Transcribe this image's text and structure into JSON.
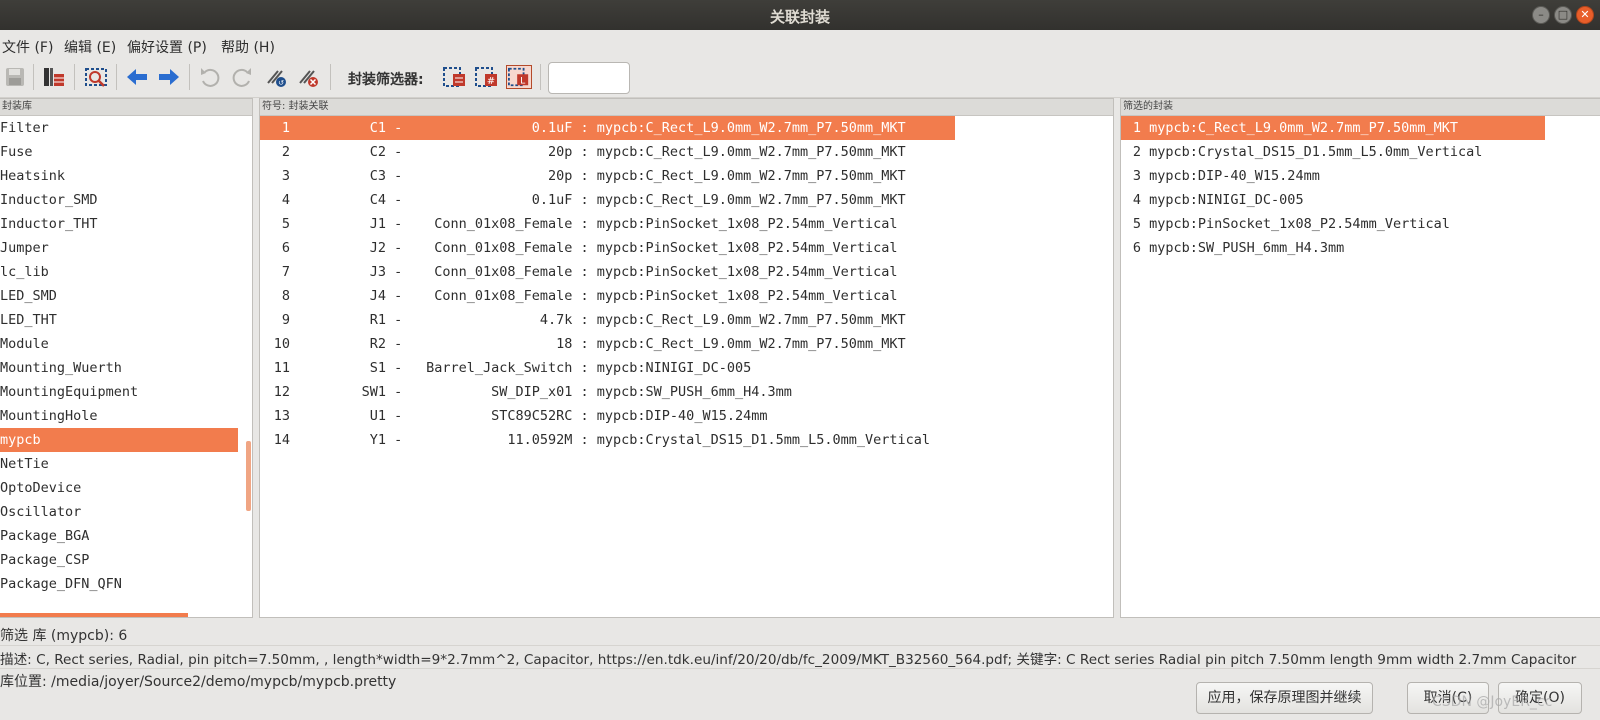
{
  "window": {
    "title": "关联封装"
  },
  "menu": {
    "items": [
      "文件 (F)",
      "编辑 (E)",
      "偏好设置 (P)",
      "帮助 (H)"
    ]
  },
  "toolbar": {
    "filter_label": "封装筛选器:",
    "filter_input_value": ""
  },
  "library_panel": {
    "header": "封装库",
    "items": [
      "Filter",
      "Fuse",
      "Heatsink",
      "Inductor_SMD",
      "Inductor_THT",
      "Jumper",
      "lc_lib",
      "LED_SMD",
      "LED_THT",
      "Module",
      "Mounting_Wuerth",
      "MountingEquipment",
      "MountingHole",
      "mypcb",
      "NetTie",
      "OptoDevice",
      "Oscillator",
      "Package_BGA",
      "Package_CSP",
      "Package_DFN_QFN"
    ],
    "selected": "mypcb"
  },
  "assoc_panel": {
    "header": "符号: 封装关联",
    "rows": [
      {
        "num": "1",
        "ref": "C1",
        "value": "0.1uF",
        "footprint": "mypcb:C_Rect_L9.0mm_W2.7mm_P7.50mm_MKT"
      },
      {
        "num": "2",
        "ref": "C2",
        "value": "20p",
        "footprint": "mypcb:C_Rect_L9.0mm_W2.7mm_P7.50mm_MKT"
      },
      {
        "num": "3",
        "ref": "C3",
        "value": "20p",
        "footprint": "mypcb:C_Rect_L9.0mm_W2.7mm_P7.50mm_MKT"
      },
      {
        "num": "4",
        "ref": "C4",
        "value": "0.1uF",
        "footprint": "mypcb:C_Rect_L9.0mm_W2.7mm_P7.50mm_MKT"
      },
      {
        "num": "5",
        "ref": "J1",
        "value": "Conn_01x08_Female",
        "footprint": "mypcb:PinSocket_1x08_P2.54mm_Vertical"
      },
      {
        "num": "6",
        "ref": "J2",
        "value": "Conn_01x08_Female",
        "footprint": "mypcb:PinSocket_1x08_P2.54mm_Vertical"
      },
      {
        "num": "7",
        "ref": "J3",
        "value": "Conn_01x08_Female",
        "footprint": "mypcb:PinSocket_1x08_P2.54mm_Vertical"
      },
      {
        "num": "8",
        "ref": "J4",
        "value": "Conn_01x08_Female",
        "footprint": "mypcb:PinSocket_1x08_P2.54mm_Vertical"
      },
      {
        "num": "9",
        "ref": "R1",
        "value": "4.7k",
        "footprint": "mypcb:C_Rect_L9.0mm_W2.7mm_P7.50mm_MKT"
      },
      {
        "num": "10",
        "ref": "R2",
        "value": "18",
        "footprint": "mypcb:C_Rect_L9.0mm_W2.7mm_P7.50mm_MKT"
      },
      {
        "num": "11",
        "ref": "S1",
        "value": "Barrel_Jack_Switch",
        "footprint": "mypcb:NINIGI_DC-005"
      },
      {
        "num": "12",
        "ref": "SW1",
        "value": "SW_DIP_x01",
        "footprint": "mypcb:SW_PUSH_6mm_H4.3mm"
      },
      {
        "num": "13",
        "ref": "U1",
        "value": "STC89C52RC",
        "footprint": "mypcb:DIP-40_W15.24mm"
      },
      {
        "num": "14",
        "ref": "Y1",
        "value": "11.0592M",
        "footprint": "mypcb:Crystal_DS15_D1.5mm_L5.0mm_Vertical"
      }
    ],
    "selected_index": 0
  },
  "filter_panel": {
    "header": "筛选的封装",
    "rows": [
      {
        "num": "1",
        "name": "mypcb:C_Rect_L9.0mm_W2.7mm_P7.50mm_MKT"
      },
      {
        "num": "2",
        "name": "mypcb:Crystal_DS15_D1.5mm_L5.0mm_Vertical"
      },
      {
        "num": "3",
        "name": "mypcb:DIP-40_W15.24mm"
      },
      {
        "num": "4",
        "name": "mypcb:NINIGI_DC-005"
      },
      {
        "num": "5",
        "name": "mypcb:PinSocket_1x08_P2.54mm_Vertical"
      },
      {
        "num": "6",
        "name": "mypcb:SW_PUSH_6mm_H4.3mm"
      }
    ],
    "selected_index": 0
  },
  "status": {
    "filter_count": "筛选 库 (mypcb): 6",
    "description": "描述:  C, Rect series, Radial, pin pitch=7.50mm, , length*width=9*2.7mm^2, Capacitor, https://en.tdk.eu/inf/20/20/db/fc_2009/MKT_B32560_564.pdf;   关键字:  C Rect series Radial pin pitch 7.50mm  length 9mm width 2.7mm Capacitor",
    "library_path": "库位置:  /media/joyer/Source2/demo/mypcb/mypcb.pretty"
  },
  "buttons": {
    "apply": "应用，保存原理图并继续",
    "cancel": "取消(C)",
    "ok": "确定(O)"
  },
  "watermark": "CSDN @JoyER_cc",
  "colors": {
    "selection": "#f27c4d",
    "titlebar": "#3a3935",
    "panel_header": "#dcdbd8"
  }
}
